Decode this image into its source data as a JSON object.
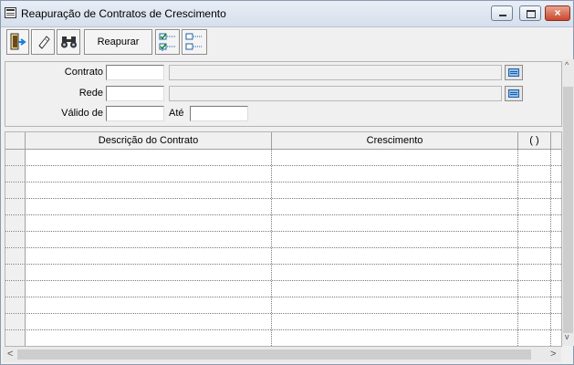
{
  "window": {
    "title": "Reapuração de Contratos de Crescimento",
    "close_glyph": "×"
  },
  "toolbar": {
    "repair_label": "Reapurar"
  },
  "form": {
    "contrato_label": "Contrato",
    "rede_label": "Rede",
    "valido_de_label": "Válido de",
    "ate_label": "Até",
    "contrato_value": "",
    "rede_value": "",
    "valido_de_value": "",
    "ate_value": ""
  },
  "grid": {
    "columns": [
      "Descrição do Contrato",
      "Crescimento",
      "( )"
    ],
    "row_count": 12
  },
  "scroll": {
    "left_arrow": "<",
    "right_arrow": ">",
    "up_arrow": "^",
    "down_arrow": "v"
  },
  "colors": {
    "accent": "#1f5fa6",
    "close": "#c9462c"
  },
  "icons": [
    "window-menu-icon",
    "exit-icon",
    "eraser-icon",
    "binoculars-icon",
    "check-list-icon",
    "uncheck-list-icon",
    "lookup-icon"
  ]
}
